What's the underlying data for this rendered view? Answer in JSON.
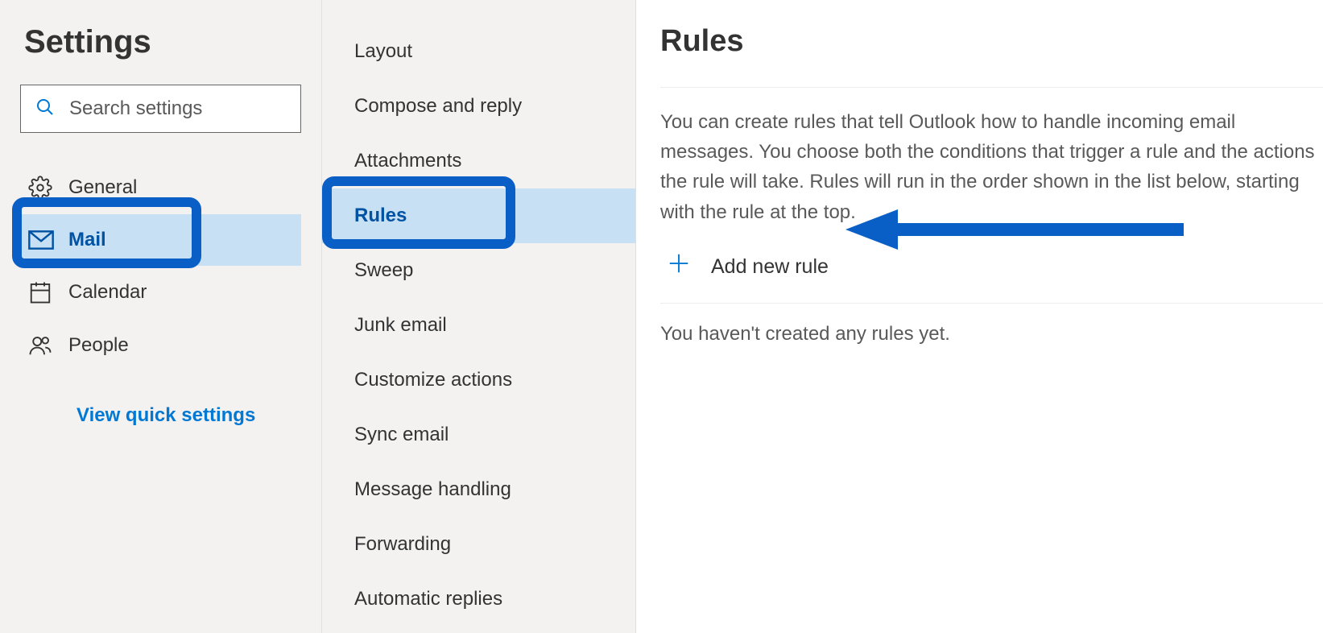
{
  "settings": {
    "title": "Settings",
    "search_placeholder": "Search settings",
    "nav": [
      {
        "label": "General"
      },
      {
        "label": "Mail"
      },
      {
        "label": "Calendar"
      },
      {
        "label": "People"
      }
    ],
    "view_quick": "View quick settings"
  },
  "mail_submenu": {
    "items": [
      "Layout",
      "Compose and reply",
      "Attachments",
      "Rules",
      "Sweep",
      "Junk email",
      "Customize actions",
      "Sync email",
      "Message handling",
      "Forwarding",
      "Automatic replies"
    ]
  },
  "rules_pane": {
    "title": "Rules",
    "description": "You can create rules that tell Outlook how to handle incoming email messages. You choose both the conditions that trigger a rule and the actions the rule will take. Rules will run in the order shown in the list below, starting with the rule at the top.",
    "add_new_label": "Add new rule",
    "empty_message": "You haven't created any rules yet."
  }
}
